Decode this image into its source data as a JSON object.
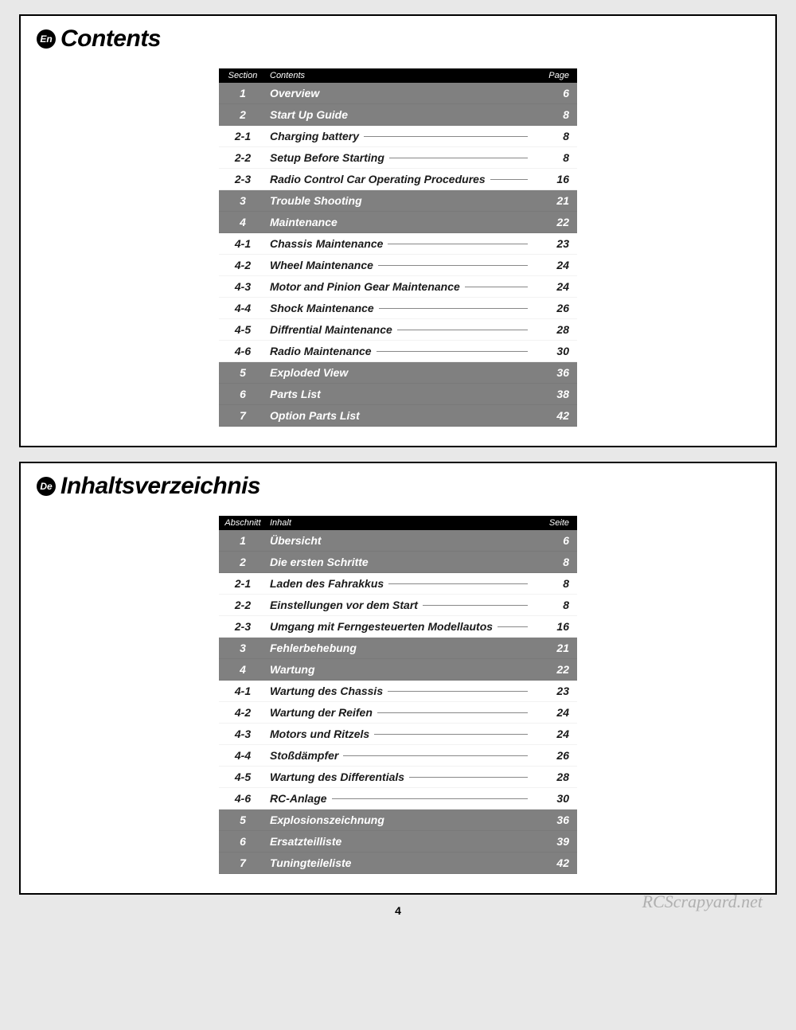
{
  "page_number": "4",
  "watermark": "RCScrapyard.net",
  "blocks": [
    {
      "lang_code": "En",
      "title": "Contents",
      "headers": {
        "section": "Section",
        "contents": "Contents",
        "page": "Page"
      },
      "rows": [
        {
          "section": "1",
          "title": "Overview",
          "page": "6",
          "type": "major"
        },
        {
          "section": "2",
          "title": "Start Up Guide",
          "page": "8",
          "type": "major"
        },
        {
          "section": "2-1",
          "title": "Charging battery",
          "page": "8",
          "type": "minor"
        },
        {
          "section": "2-2",
          "title": "Setup Before Starting",
          "page": "8",
          "type": "minor"
        },
        {
          "section": "2-3",
          "title": "Radio Control Car Operating Procedures",
          "page": "16",
          "type": "minor"
        },
        {
          "section": "3",
          "title": "Trouble Shooting",
          "page": "21",
          "type": "major"
        },
        {
          "section": "4",
          "title": "Maintenance",
          "page": "22",
          "type": "major"
        },
        {
          "section": "4-1",
          "title": "Chassis Maintenance",
          "page": "23",
          "type": "minor"
        },
        {
          "section": "4-2",
          "title": "Wheel Maintenance",
          "page": "24",
          "type": "minor"
        },
        {
          "section": "4-3",
          "title": "Motor and Pinion Gear Maintenance",
          "page": "24",
          "type": "minor"
        },
        {
          "section": "4-4",
          "title": "Shock Maintenance",
          "page": "26",
          "type": "minor"
        },
        {
          "section": "4-5",
          "title": "Diffrential Maintenance",
          "page": "28",
          "type": "minor"
        },
        {
          "section": "4-6",
          "title": "Radio Maintenance",
          "page": "30",
          "type": "minor"
        },
        {
          "section": "5",
          "title": "Exploded View",
          "page": "36",
          "type": "major"
        },
        {
          "section": "6",
          "title": "Parts List",
          "page": "38",
          "type": "major"
        },
        {
          "section": "7",
          "title": "Option Parts List",
          "page": "42",
          "type": "major"
        }
      ]
    },
    {
      "lang_code": "De",
      "title": "Inhaltsverzeichnis",
      "headers": {
        "section": "Abschnitt",
        "contents": "Inhalt",
        "page": "Seite"
      },
      "rows": [
        {
          "section": "1",
          "title": "Übersicht",
          "page": "6",
          "type": "major"
        },
        {
          "section": "2",
          "title": "Die ersten Schritte",
          "page": "8",
          "type": "major"
        },
        {
          "section": "2-1",
          "title": "Laden des Fahrakkus",
          "page": "8",
          "type": "minor"
        },
        {
          "section": "2-2",
          "title": "Einstellungen vor dem Start",
          "page": "8",
          "type": "minor"
        },
        {
          "section": "2-3",
          "title": "Umgang mit Ferngesteuerten Modellautos",
          "page": "16",
          "type": "minor"
        },
        {
          "section": "3",
          "title": "Fehlerbehebung",
          "page": "21",
          "type": "major"
        },
        {
          "section": "4",
          "title": "Wartung",
          "page": "22",
          "type": "major"
        },
        {
          "section": "4-1",
          "title": "Wartung des Chassis",
          "page": "23",
          "type": "minor"
        },
        {
          "section": "4-2",
          "title": "Wartung der Reifen",
          "page": "24",
          "type": "minor"
        },
        {
          "section": "4-3",
          "title": "Motors und Ritzels",
          "page": "24",
          "type": "minor"
        },
        {
          "section": "4-4",
          "title": "Stoßdämpfer",
          "page": "26",
          "type": "minor"
        },
        {
          "section": "4-5",
          "title": "Wartung des Differentials",
          "page": "28",
          "type": "minor"
        },
        {
          "section": "4-6",
          "title": "RC-Anlage",
          "page": "30",
          "type": "minor"
        },
        {
          "section": "5",
          "title": "Explosionszeichnung",
          "page": "36",
          "type": "major"
        },
        {
          "section": "6",
          "title": "Ersatzteilliste",
          "page": "39",
          "type": "major"
        },
        {
          "section": "7",
          "title": "Tuningteileliste",
          "page": "42",
          "type": "major"
        }
      ]
    }
  ]
}
